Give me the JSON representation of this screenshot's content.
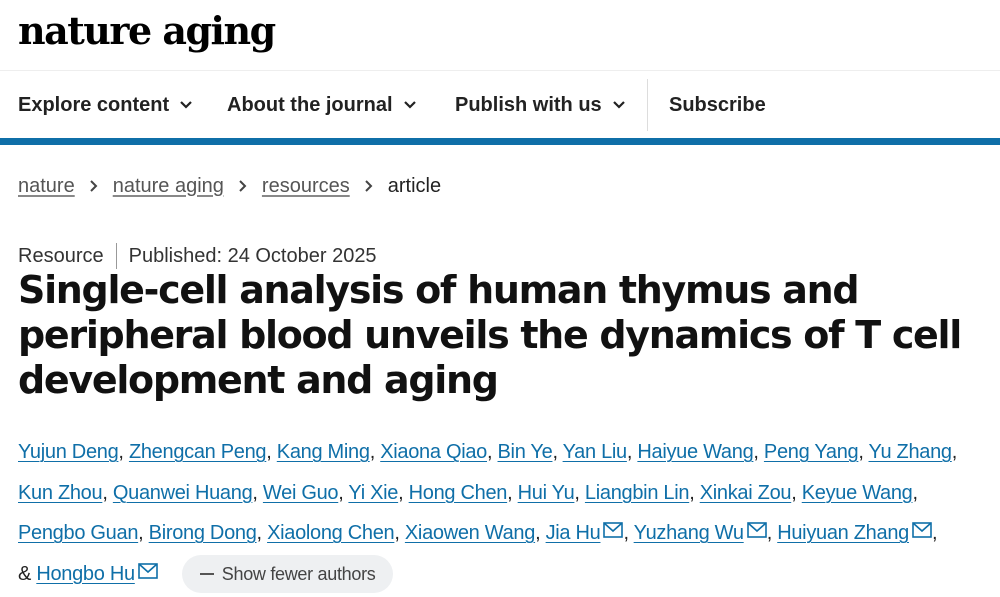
{
  "header": {
    "logo": "nature aging"
  },
  "nav": {
    "items": [
      {
        "label": "Explore content"
      },
      {
        "label": "About the journal"
      },
      {
        "label": "Publish with us"
      }
    ],
    "subscribe": "Subscribe"
  },
  "breadcrumb": {
    "links": [
      "nature",
      "nature aging",
      "resources"
    ],
    "current": "article"
  },
  "article": {
    "type": "Resource",
    "published": "Published: 24 October 2025",
    "title": "Single-cell analysis of human thymus and peripheral blood unveils the dynamics of T cell development and aging"
  },
  "authors": {
    "list": [
      "Yujun Deng",
      "Zhengcan Peng",
      "Kang Ming",
      "Xiaona Qiao",
      "Bin Ye",
      "Yan Liu",
      "Haiyue Wang",
      "Peng Yang",
      "Yu Zhang",
      "Kun Zhou",
      "Quanwei Huang",
      "Wei Guo",
      "Yi Xie",
      "Hong Chen",
      "Hui Yu",
      "Liangbin Lin",
      "Xinkai Zou",
      "Keyue Wang",
      "Pengbo Guan",
      "Birong Dong",
      "Xiaolong Chen",
      "Xiaowen Wang",
      "Jia Hu",
      "Yuzhang Wu",
      "Huiyuan Zhang"
    ],
    "last_prefix": "&",
    "last": "Hongbo Hu",
    "show_fewer": "Show fewer authors"
  },
  "colors": {
    "link": "#0f6fa8",
    "nav_bar": "#0f6fa8"
  }
}
